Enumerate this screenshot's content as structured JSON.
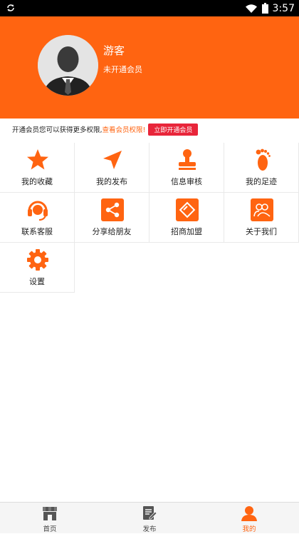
{
  "status_bar": {
    "time": "3:57",
    "icons": [
      "sync-icon",
      "wifi-icon",
      "battery-icon"
    ]
  },
  "colors": {
    "accent": "#ff6411",
    "cta": "#e8253a",
    "status_bar": "#000000"
  },
  "profile": {
    "name": "游客",
    "membership": "未开通会员"
  },
  "notice": {
    "text": "开通会员您可以获得更多权限,",
    "link": "查看会员权限!",
    "button": "立即开通会员"
  },
  "menu": [
    {
      "label": "我的收藏",
      "icon": "star-icon"
    },
    {
      "label": "我的发布",
      "icon": "send-icon"
    },
    {
      "label": "信息审核",
      "icon": "stamp-icon"
    },
    {
      "label": "我的足迹",
      "icon": "footprint-icon"
    },
    {
      "label": "联系客服",
      "icon": "headset-icon"
    },
    {
      "label": "分享给朋友",
      "icon": "share-icon"
    },
    {
      "label": "招商加盟",
      "icon": "handshake-icon"
    },
    {
      "label": "关于我们",
      "icon": "group-icon"
    },
    {
      "label": "设置",
      "icon": "gear-icon"
    }
  ],
  "tabbar": {
    "items": [
      {
        "label": "首页",
        "icon": "store-icon"
      },
      {
        "label": "发布",
        "icon": "edit-icon"
      },
      {
        "label": "我的",
        "icon": "user-icon"
      }
    ],
    "active": "我的"
  }
}
